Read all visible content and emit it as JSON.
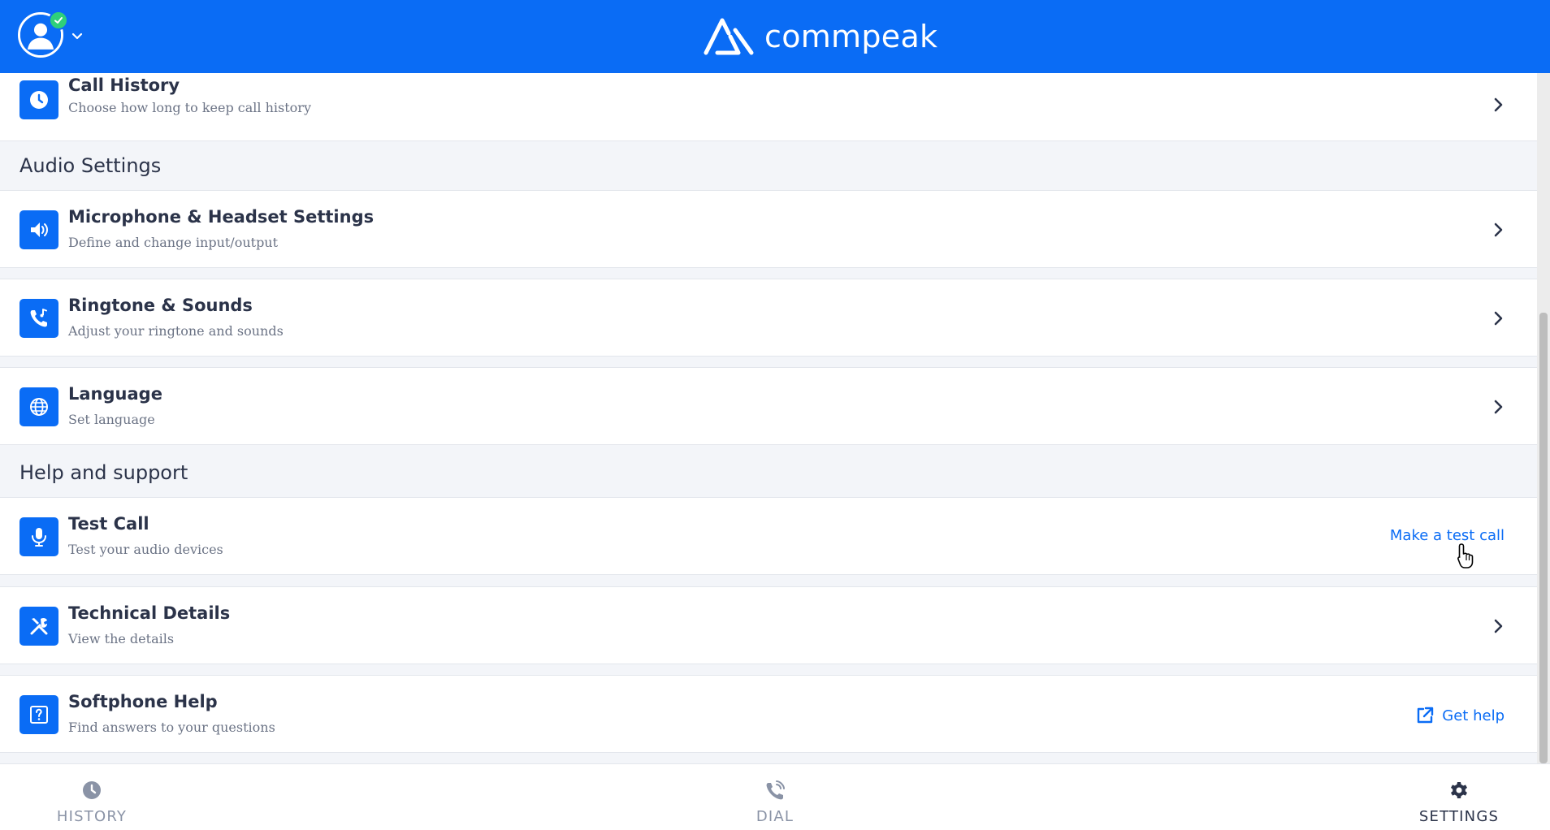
{
  "header": {
    "brand_name": "commpeak",
    "colors": {
      "primary": "#0a6cf5",
      "presence": "#2fd07a"
    }
  },
  "rows": {
    "call_history": {
      "title": "Call History",
      "subtitle": "Choose how long to keep call history",
      "icon": "clock-icon"
    },
    "microphone": {
      "title": "Microphone & Headset Settings",
      "subtitle": "Define and change input/output",
      "icon": "speaker-icon"
    },
    "ringtone": {
      "title": "Ringtone & Sounds",
      "subtitle": "Adjust your ringtone and sounds",
      "icon": "phone-music-icon"
    },
    "language": {
      "title": "Language",
      "subtitle": "Set language",
      "icon": "globe-icon"
    },
    "test_call": {
      "title": "Test Call",
      "subtitle": "Test your audio devices",
      "action": "Make a test call",
      "icon": "microphone-icon"
    },
    "technical": {
      "title": "Technical Details",
      "subtitle": "View the details",
      "icon": "tools-icon"
    },
    "softphone_help": {
      "title": "Softphone Help",
      "subtitle": "Find answers to your questions",
      "action": "Get help",
      "icon": "question-icon"
    }
  },
  "sections": {
    "audio": "Audio Settings",
    "help": "Help and support"
  },
  "nav": {
    "history": "HISTORY",
    "dial": "DIAL",
    "settings": "SETTINGS",
    "active": "settings"
  }
}
